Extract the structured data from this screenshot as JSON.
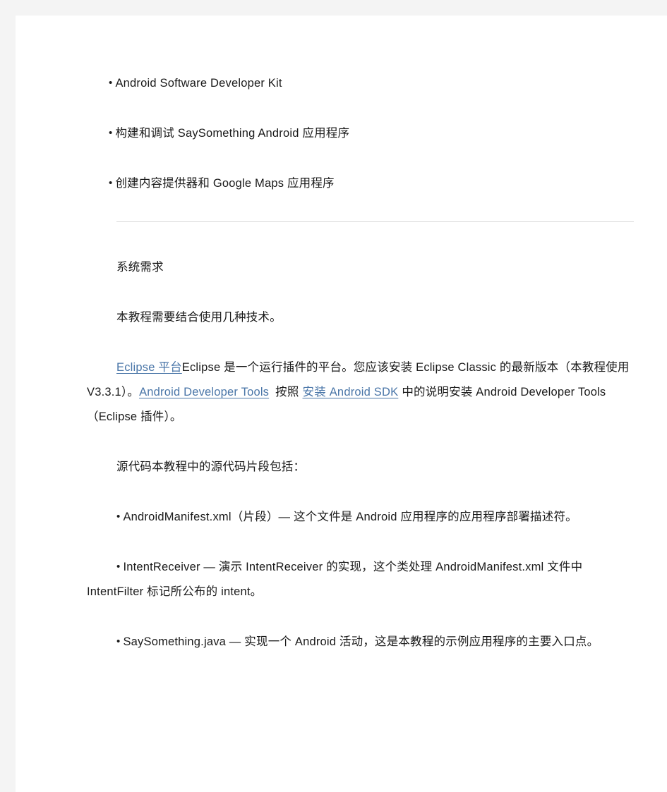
{
  "document": {
    "background_color": "#f4f4f4",
    "page_color": "#ffffff",
    "text_color": "#1a1a1a",
    "link_color": "#4a76a8",
    "rule_color": "#d6d6d6"
  },
  "bullet_marker": "•",
  "top_bullets": [
    {
      "text": "Android  Software  Developer  Kit"
    },
    {
      "text": "构建和调试 SaySomething Android  应用程序"
    },
    {
      "text": "创建内容提供器和 Google Maps  应用程序"
    }
  ],
  "section": {
    "heading": "系统需求",
    "intro": "本教程需要结合使用几种技术。",
    "requirements_paragraph": {
      "link_eclipse_platform": "Eclipse  平台",
      "after_eclipse_link": "Eclipse  是一个运行插件的平台。您应该安装 Eclipse Classic  的最新版本（本教程使用 V3.3.1）。",
      "link_android_developer_tools": "Android Developer Tools",
      "after_adt_link": "按照",
      "link_install_android_sdk": "安装 Android SDK",
      "tail": "中的说明安装 Android Developer Tools（Eclipse  插件）。"
    },
    "source_paragraph": "源代码本教程中的源代码片段包括：",
    "source_bullets": [
      {
        "text": "AndroidManifest.xml（片段）— 这个文件是 Android  应用程序的应用程序部署描述符。"
      },
      {
        "text": "IntentReceiver — 演示 IntentReceiver  的实现，这个类处理 AndroidManifest.xml  文件中 IntentFilter  标记所公布的 intent。"
      },
      {
        "text": "SaySomething.java — 实现一个 Android  活动，这是本教程的示例应用程序的主要入口点。"
      }
    ]
  }
}
